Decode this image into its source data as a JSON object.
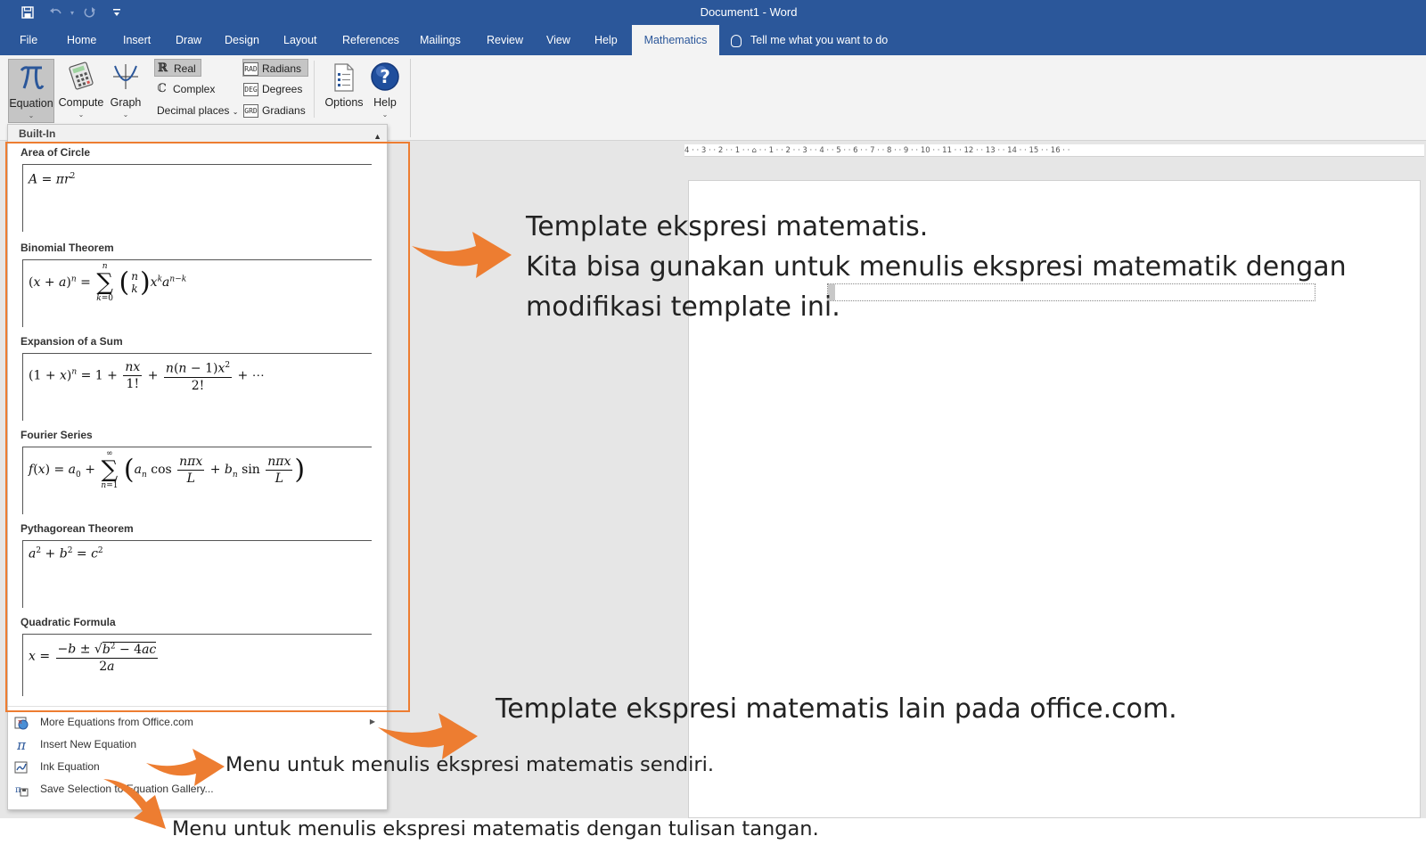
{
  "window": {
    "title": "Document1  -  Word",
    "quick_access": {
      "save_icon": "save-icon",
      "undo_icon": "undo-icon",
      "redo_icon": "redo-icon",
      "customize_icon": "customize-qat-icon"
    }
  },
  "tabs": [
    {
      "label": "File"
    },
    {
      "label": "Home"
    },
    {
      "label": "Insert"
    },
    {
      "label": "Draw"
    },
    {
      "label": "Design"
    },
    {
      "label": "Layout"
    },
    {
      "label": "References"
    },
    {
      "label": "Mailings"
    },
    {
      "label": "Review"
    },
    {
      "label": "View"
    },
    {
      "label": "Help"
    },
    {
      "label": "Mathematics",
      "active": true
    }
  ],
  "tell_me": "Tell me what you want to do",
  "ribbon": {
    "equation": "Equation",
    "compute": "Compute",
    "graph": "Graph",
    "real": "Real",
    "complex": "Complex",
    "decimal_places": "Decimal places",
    "radians": "Radians",
    "degrees": "Degrees",
    "gradians": "Gradians",
    "options": "Options",
    "help": "Help",
    "rad_icon": "RAD",
    "deg_icon": "DEG",
    "grd_icon": "GRD"
  },
  "gallery": {
    "header": "Built-In",
    "items": [
      {
        "title": "Area of Circle"
      },
      {
        "title": "Binomial Theorem"
      },
      {
        "title": "Expansion of a Sum"
      },
      {
        "title": "Fourier Series"
      },
      {
        "title": "Pythagorean Theorem"
      },
      {
        "title": "Quadratic Formula"
      }
    ],
    "menu": [
      {
        "label": "More Equations from Office.com",
        "icon": "office-equations-icon"
      },
      {
        "label": "Insert New Equation",
        "icon": "pi-icon"
      },
      {
        "label": "Ink Equation",
        "icon": "ink-equation-icon"
      },
      {
        "label": "Save Selection to Equation Gallery...",
        "icon": "save-selection-icon"
      }
    ]
  },
  "ruler": {
    "text": "4 · · 3 · · 2 · · 1 · · ⌂ · · 1 · · 2 · · 3 · · 4 · · 5 · · 6 · · 7 · · 8 · · 9 · · 10 · · 11 · · 12 · · 13 · · 14 · · 15 · · 16 · ·"
  },
  "annotations": {
    "note1_line1": "Template ekspresi matematis.",
    "note1_line2": "Kita bisa gunakan untuk menulis ekspresi matematik dengan",
    "note1_line3": "modifikasi template ini.",
    "note2": "Template ekspresi matematis lain pada office.com.",
    "note3": "Menu untuk menulis ekspresi  matematis sendiri.",
    "note4": "Menu untuk menulis ekspresi  matematis dengan tulisan tangan."
  },
  "colors": {
    "title_bar": "#2b579a",
    "annotation_arrow": "#ed7d31",
    "gallery_highlight": "#ed7d31"
  }
}
